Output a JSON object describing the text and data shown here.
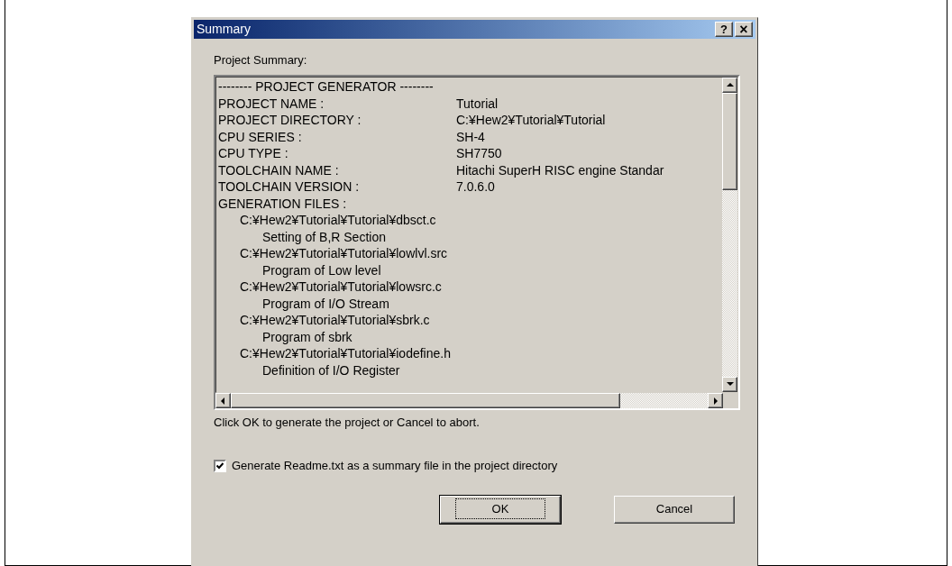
{
  "window": {
    "title": "Summary",
    "help_button": "?",
    "close_button": "×"
  },
  "summary_label": "Project Summary:",
  "summary": {
    "header": "-------- PROJECT GENERATOR --------",
    "fields": [
      {
        "label": "PROJECT NAME :",
        "value": "Tutorial"
      },
      {
        "label": "PROJECT DIRECTORY :",
        "value": "C:¥Hew2¥Tutorial¥Tutorial"
      },
      {
        "label": "CPU SERIES :",
        "value": "SH-4"
      },
      {
        "label": "CPU TYPE :",
        "value": "SH7750"
      },
      {
        "label": "TOOLCHAIN NAME :",
        "value": "Hitachi SuperH RISC engine Standar"
      },
      {
        "label": "TOOLCHAIN VERSION :",
        "value": "7.0.6.0"
      }
    ],
    "files": {
      "label": "GENERATION FILES :",
      "children": [
        {
          "path": "C:¥Hew2¥Tutorial¥Tutorial¥dbsct.c",
          "children": [
            {
              "text": "Setting of B,R Section"
            }
          ]
        },
        {
          "path": "C:¥Hew2¥Tutorial¥Tutorial¥lowlvl.src",
          "children": [
            {
              "text": "Program of Low level"
            }
          ]
        },
        {
          "path": "C:¥Hew2¥Tutorial¥Tutorial¥lowsrc.c",
          "children": [
            {
              "text": "Program of I/O Stream"
            }
          ]
        },
        {
          "path": "C:¥Hew2¥Tutorial¥Tutorial¥sbrk.c",
          "children": [
            {
              "text": "Program of sbrk"
            }
          ]
        },
        {
          "path": "C:¥Hew2¥Tutorial¥Tutorial¥iodefine.h",
          "children": [
            {
              "text": "Definition of I/O Register"
            }
          ]
        }
      ]
    }
  },
  "hint": "Click OK to generate the project or Cancel to abort.",
  "readme_checkbox": {
    "label": "Generate Readme.txt as a summary file in the project directory",
    "checked": true
  },
  "buttons": [
    {
      "label": "OK",
      "default": true
    },
    {
      "label": "Cancel",
      "default": false
    }
  ]
}
